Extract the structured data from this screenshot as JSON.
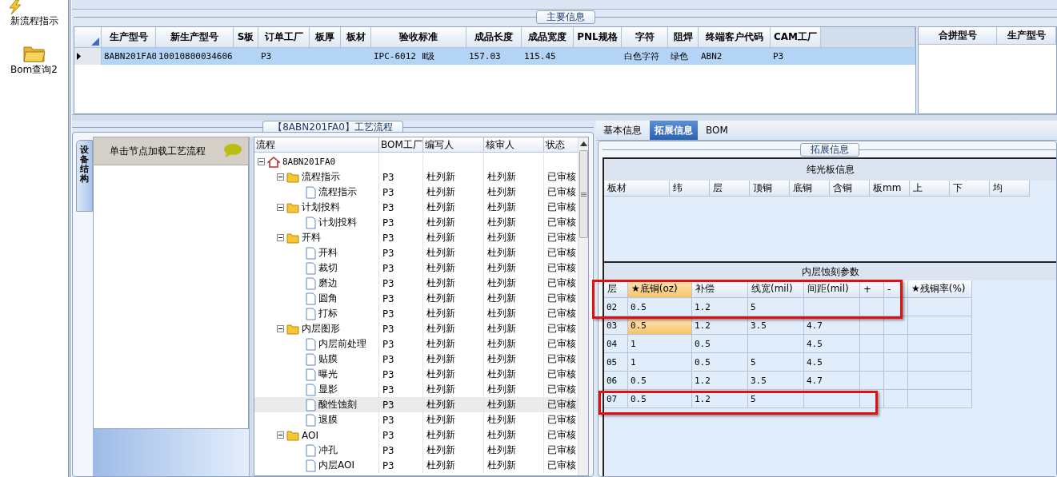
{
  "sidebar": {
    "items": [
      {
        "label": "新流程指示",
        "kind": "lightning"
      },
      {
        "label": "Bom查询2",
        "kind": "folder"
      }
    ]
  },
  "main_info": {
    "title": "主要信息",
    "columns": [
      "生产型号",
      "新生产型号",
      "S板",
      "订单工厂",
      "板厚",
      "板材",
      "验收标准",
      "成品长度",
      "成品宽度",
      "PNL规格",
      "字符",
      "阻焊",
      "终端客户代码",
      "CAM工厂"
    ],
    "rows": [
      {
        "selected": true,
        "cells": [
          "8ABN201FA0",
          "10010800034606",
          null,
          "P3",
          null,
          null,
          "IPC-6012 Ⅱ级",
          "157.03",
          "115.45",
          null,
          "白色字符",
          "绿色",
          "ABN2",
          "P3"
        ]
      }
    ],
    "side_columns": [
      "合拼型号",
      "生产型号"
    ]
  },
  "process": {
    "title": "【8ABN201FA0】工艺流程",
    "side_tab": "设备结构",
    "hint": "单击节点加载工艺流程",
    "columns": [
      "流程",
      "BOM工厂",
      "编写人",
      "核审人",
      "状态"
    ],
    "tree": {
      "label": "8ABN201FA0",
      "kind": "root",
      "expanded": true,
      "selected": false,
      "children": [
        {
          "label": "流程指示",
          "kind": "folder",
          "expanded": true,
          "selected": false,
          "bom": "P3",
          "writer": "杜列新",
          "reviewer": "杜列新",
          "status": "已审核",
          "children": [
            {
              "label": "流程指示",
              "kind": "step",
              "selected": false,
              "bom": "P3",
              "writer": "杜列新",
              "reviewer": "杜列新",
              "status": "已审核"
            }
          ]
        },
        {
          "label": "计划投料",
          "kind": "folder",
          "expanded": true,
          "selected": false,
          "bom": "P3",
          "writer": "杜列新",
          "reviewer": "杜列新",
          "status": "已审核",
          "children": [
            {
              "label": "计划投料",
              "kind": "step",
              "selected": false,
              "bom": "P3",
              "writer": "杜列新",
              "reviewer": "杜列新",
              "status": "已审核"
            }
          ]
        },
        {
          "label": "开料",
          "kind": "folder",
          "expanded": true,
          "selected": false,
          "bom": "P3",
          "writer": "杜列新",
          "reviewer": "杜列新",
          "status": "已审核",
          "children": [
            {
              "label": "开料",
              "kind": "step",
              "selected": false,
              "bom": "P3",
              "writer": "杜列新",
              "reviewer": "杜列新",
              "status": "已审核"
            },
            {
              "label": "裁切",
              "kind": "step",
              "selected": false,
              "bom": "P3",
              "writer": "杜列新",
              "reviewer": "杜列新",
              "status": "已审核"
            },
            {
              "label": "磨边",
              "kind": "step",
              "selected": false,
              "bom": "P3",
              "writer": "杜列新",
              "reviewer": "杜列新",
              "status": "已审核"
            },
            {
              "label": "圆角",
              "kind": "step",
              "selected": false,
              "bom": "P3",
              "writer": "杜列新",
              "reviewer": "杜列新",
              "status": "已审核"
            },
            {
              "label": "打标",
              "kind": "step",
              "selected": false,
              "bom": "P3",
              "writer": "杜列新",
              "reviewer": "杜列新",
              "status": "已审核"
            }
          ]
        },
        {
          "label": "内层图形",
          "kind": "folder",
          "expanded": true,
          "selected": false,
          "bom": "P3",
          "writer": "杜列新",
          "reviewer": "杜列新",
          "status": "已审核",
          "children": [
            {
              "label": "内层前处理",
              "kind": "step",
              "selected": false,
              "bom": "P3",
              "writer": "杜列新",
              "reviewer": "杜列新",
              "status": "已审核"
            },
            {
              "label": "贴膜",
              "kind": "step",
              "selected": false,
              "bom": "P3",
              "writer": "杜列新",
              "reviewer": "杜列新",
              "status": "已审核"
            },
            {
              "label": "曝光",
              "kind": "step",
              "selected": false,
              "bom": "P3",
              "writer": "杜列新",
              "reviewer": "杜列新",
              "status": "已审核"
            },
            {
              "label": "显影",
              "kind": "step",
              "selected": false,
              "bom": "P3",
              "writer": "杜列新",
              "reviewer": "杜列新",
              "status": "已审核"
            },
            {
              "label": "酸性蚀刻",
              "kind": "step",
              "selected": true,
              "bom": "P3",
              "writer": "杜列新",
              "reviewer": "杜列新",
              "status": "已审核"
            },
            {
              "label": "退膜",
              "kind": "step",
              "selected": false,
              "bom": "P3",
              "writer": "杜列新",
              "reviewer": "杜列新",
              "status": "已审核"
            }
          ]
        },
        {
          "label": "AOI",
          "kind": "folder",
          "expanded": true,
          "selected": false,
          "bom": "P3",
          "writer": "杜列新",
          "reviewer": "杜列新",
          "status": "已审核",
          "children": [
            {
              "label": "冲孔",
              "kind": "step",
              "selected": false,
              "bom": "P3",
              "writer": "杜列新",
              "reviewer": "杜列新",
              "status": "已审核"
            },
            {
              "label": "内层AOI",
              "kind": "step",
              "selected": false,
              "bom": "P3",
              "writer": "杜列新",
              "reviewer": "杜列新",
              "status": "已审核"
            }
          ]
        }
      ]
    }
  },
  "detail": {
    "tabs": [
      {
        "label": "基本信息",
        "selected": false
      },
      {
        "label": "拓展信息",
        "selected": true
      },
      {
        "label": "BOM",
        "selected": false
      }
    ],
    "group_title": "拓展信息",
    "plain_board": {
      "title": "纯光板信息",
      "columns": [
        "板材",
        "纬",
        "层",
        "顶铜",
        "底铜",
        "含铜",
        "板mm",
        "上",
        "下",
        "均"
      ]
    },
    "etch": {
      "title": "内层蚀刻参数",
      "columns": [
        {
          "label": "层",
          "selected": false
        },
        {
          "label": "★底铜(oz)",
          "selected": true
        },
        {
          "label": "补偿",
          "selected": false
        },
        {
          "label": "线宽(mil)",
          "selected": false
        },
        {
          "label": "间距(mil)",
          "selected": false
        },
        {
          "label": "+",
          "selected": false
        },
        {
          "label": "-",
          "selected": false
        },
        {
          "label": "★残铜率(%)",
          "selected": false
        }
      ],
      "rows": [
        {
          "selected": false,
          "cells": [
            "02",
            "0.5",
            "1.2",
            "5",
            null,
            null,
            null,
            null
          ]
        },
        {
          "selected": true,
          "cells": [
            "03",
            "0.5",
            "1.2",
            "3.5",
            "4.7",
            null,
            null,
            null
          ]
        },
        {
          "selected": false,
          "cells": [
            "04",
            "1",
            "0.5",
            null,
            "4.5",
            null,
            null,
            null
          ]
        },
        {
          "selected": false,
          "cells": [
            "05",
            "1",
            "0.5",
            "5",
            "4.5",
            null,
            null,
            null
          ]
        },
        {
          "selected": false,
          "cells": [
            "06",
            "0.5",
            "1.2",
            "3.5",
            "4.7",
            null,
            null,
            null
          ]
        },
        {
          "selected": false,
          "cells": [
            "07",
            "0.5",
            "1.2",
            "5",
            null,
            null,
            null,
            null
          ]
        }
      ]
    }
  },
  "annotations": [
    {
      "kind": "box"
    },
    {
      "kind": "box"
    }
  ]
}
